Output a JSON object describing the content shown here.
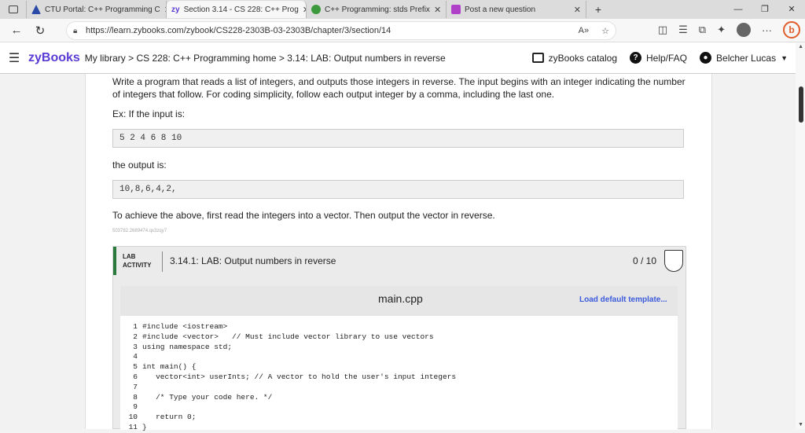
{
  "browser": {
    "tabs": [
      {
        "label": "CTU Portal: C++ Programming C"
      },
      {
        "label": "Section 3.14 - CS 228: C++ Prog"
      },
      {
        "label": "C++ Programming: stds Prefix"
      },
      {
        "label": "Post a new question"
      }
    ],
    "new_tab": "+",
    "url": "https://learn.zybooks.com/zybook/CS228-2303B-03-2303B/chapter/3/section/14",
    "window_controls": [
      "—",
      "❐",
      "✕"
    ]
  },
  "header": {
    "logo": "zyBooks",
    "breadcrumb": "My library > CS 228: C++ Programming home > 3.14: LAB: Output numbers in reverse",
    "catalog_label": "zyBooks catalog",
    "help_label": "Help/FAQ",
    "user_label": "Belcher Lucas"
  },
  "content": {
    "intro_line1": "Write a program that reads a list of integers, and outputs those integers in reverse. The input begins with an integer indicating the number",
    "intro_line2": "of integers that follow. For coding simplicity, follow each output integer by a comma, including the last one.",
    "example_label": "Ex: If the input is:",
    "example_input": "5 2 4 6 8 10",
    "output_label": "the output is:",
    "example_output": "10,8,6,4,2,",
    "hint": "To achieve the above, first read the integers into a vector. Then output the vector in reverse.",
    "small_id": "503782.2689474.qx3zqy7"
  },
  "lab": {
    "tag_line1": "LAB",
    "tag_line2": "ACTIVITY",
    "title": "3.14.1: LAB: Output numbers in reverse",
    "score": "0 / 10",
    "filename": "main.cpp",
    "load_template": "Load default template...",
    "code_lines": [
      {
        "no": "1",
        "text": "#include <iostream>"
      },
      {
        "no": "2",
        "text": "#include <vector>   // Must include vector library to use vectors"
      },
      {
        "no": "3",
        "text": "using namespace std;"
      },
      {
        "no": "4",
        "text": ""
      },
      {
        "no": "5",
        "text": "int main() {"
      },
      {
        "no": "6",
        "text": "   vector<int> userInts; // A vector to hold the user's input integers"
      },
      {
        "no": "7",
        "text": ""
      },
      {
        "no": "8",
        "text": "   /* Type your code here. */"
      },
      {
        "no": "9",
        "text": ""
      },
      {
        "no": "10",
        "text": "   return 0;"
      },
      {
        "no": "11",
        "text": "}"
      }
    ]
  }
}
